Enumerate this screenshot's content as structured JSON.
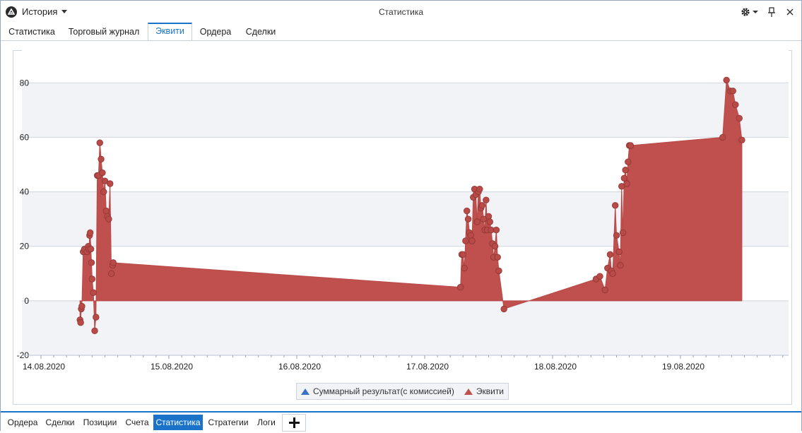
{
  "app": {
    "menu_label": "История",
    "window_title": "Статистика"
  },
  "icons": {
    "logo": "app-logo-icon",
    "settings": "gear-icon",
    "pin": "pin-icon",
    "close": "close-icon",
    "add": "plus-icon"
  },
  "tabs": [
    {
      "label": "Статистика"
    },
    {
      "label": "Торговый журнал"
    },
    {
      "label": "Эквити"
    },
    {
      "label": "Ордера"
    },
    {
      "label": "Сделки"
    }
  ],
  "active_tab": "Эквити",
  "legend": [
    {
      "label": "Суммарный результат(с комиссией)",
      "color": "#3b73c4"
    },
    {
      "label": "Эквити",
      "color": "#c0504d"
    }
  ],
  "bottom_tabs": [
    {
      "label": "Ордера"
    },
    {
      "label": "Сделки"
    },
    {
      "label": "Позиции"
    },
    {
      "label": "Счета"
    },
    {
      "label": "Статистика"
    },
    {
      "label": "Стратегии"
    },
    {
      "label": "Логи"
    }
  ],
  "active_bottom_tab": "Статистика",
  "colors": {
    "accent": "#1a73c8",
    "equity_fill": "#c0504d",
    "equity_marker": "#b84a47",
    "band": "#f2f3f7"
  },
  "chart_data": {
    "type": "area",
    "x_tick_labels": [
      "14.08.2020",
      "15.08.2020",
      "16.08.2020",
      "17.08.2020",
      "18.08.2020",
      "19.08.2020"
    ],
    "y_tick_labels": [
      "-20",
      "0",
      "20",
      "40",
      "60",
      "80"
    ],
    "ylim": [
      -20,
      92
    ],
    "grid": true,
    "legend_position": "bottom",
    "series": [
      {
        "name": "Суммарный результат(с комиссией)",
        "values": []
      },
      {
        "name": "Эквити",
        "x": [
          0.305,
          0.31,
          0.315,
          0.32,
          0.33,
          0.34,
          0.36,
          0.37,
          0.375,
          0.38,
          0.385,
          0.39,
          0.395,
          0.4,
          0.41,
          0.42,
          0.43,
          0.44,
          0.45,
          0.46,
          0.47,
          0.48,
          0.49,
          0.5,
          0.51,
          0.52,
          0.53,
          0.54,
          0.55,
          0.56,
          0.565,
          3.28,
          3.29,
          3.3,
          3.31,
          3.32,
          3.33,
          3.34,
          3.35,
          3.36,
          3.37,
          3.38,
          3.39,
          3.4,
          3.41,
          3.42,
          3.43,
          3.44,
          3.45,
          3.46,
          3.47,
          3.48,
          3.49,
          3.5,
          3.51,
          3.52,
          3.53,
          3.54,
          3.55,
          3.56,
          3.57,
          3.58,
          3.62,
          4.34,
          4.37,
          4.41,
          4.43,
          4.45,
          4.46,
          4.47,
          4.49,
          4.5,
          4.52,
          4.53,
          4.54,
          4.55,
          4.56,
          4.57,
          4.58,
          4.59,
          4.6,
          4.61,
          5.33,
          5.36,
          5.39,
          5.41,
          5.43,
          5.46,
          5.48
        ],
        "values": [
          -7,
          -8,
          -3,
          -2,
          18,
          19,
          18,
          20,
          19,
          24,
          25,
          19,
          14,
          8,
          3,
          -11,
          -6,
          46,
          46,
          58,
          52,
          47,
          40,
          44,
          33,
          31,
          30,
          43,
          10,
          13,
          14,
          5,
          17,
          17,
          12,
          22,
          33,
          30,
          25,
          24,
          22,
          38,
          41,
          39,
          29,
          40,
          41,
          34,
          35,
          30,
          26,
          37,
          26,
          31,
          29,
          26,
          21,
          16,
          20,
          26,
          16,
          11,
          -3,
          8,
          9,
          4,
          12,
          17,
          11,
          10,
          35,
          24,
          18,
          13,
          42,
          25,
          45,
          48,
          43,
          51,
          57,
          57,
          60,
          81,
          77,
          77,
          72,
          67,
          59
        ]
      }
    ]
  }
}
